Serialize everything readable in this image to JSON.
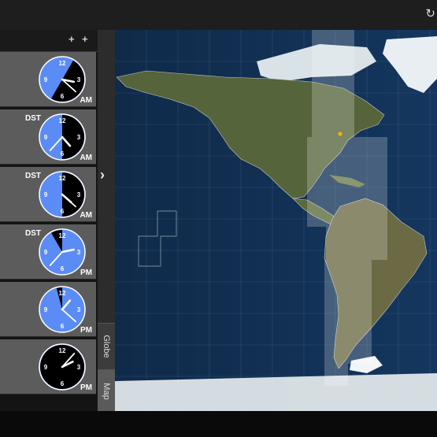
{
  "toolbar": {
    "corner_icon": "refresh-icon"
  },
  "clocks": [
    {
      "dst": "",
      "ampm": "AM",
      "hour": 3,
      "minute": 22,
      "night": [
        1.0,
        7.0
      ]
    },
    {
      "dst": "DST",
      "ampm": "AM",
      "hour": 4,
      "minute": 37,
      "night": [
        0.0,
        6.0
      ]
    },
    {
      "dst": "DST",
      "ampm": "AM",
      "hour": 4,
      "minute": 22,
      "night": [
        0.0,
        6.0
      ]
    },
    {
      "dst": "DST",
      "ampm": "PM",
      "hour": 2,
      "minute": 37,
      "night": [
        11.0,
        12.0
      ]
    },
    {
      "dst": "",
      "ampm": "PM",
      "hour": 1,
      "minute": 22,
      "night": [
        11.5,
        12.0
      ]
    },
    {
      "dst": "",
      "ampm": "PM",
      "hour": 2,
      "minute": 7,
      "night": [
        0.0,
        12.0
      ]
    }
  ],
  "view_tabs": {
    "globe": "Globe",
    "map": "Map",
    "active": "Map"
  },
  "colors": {
    "day_face": "#5b8cf5",
    "night_face": "#000000",
    "card_bg": "#5c5c5c",
    "ocean": "#14365e"
  },
  "map_marker": {
    "label": "current-location"
  }
}
